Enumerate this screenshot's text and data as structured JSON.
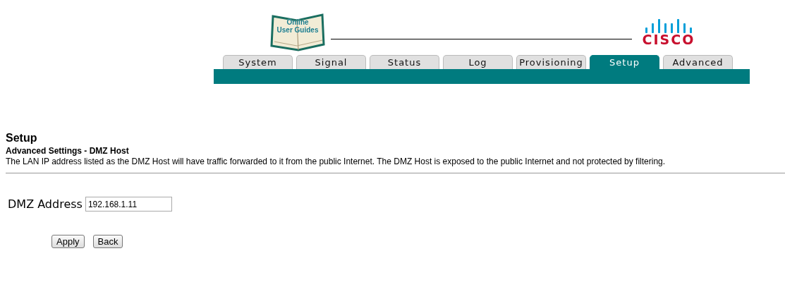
{
  "header": {
    "guide_logo": [
      "Online",
      "User Guides"
    ],
    "brand": "CISCO"
  },
  "tabs": [
    {
      "label": "System",
      "selected": false
    },
    {
      "label": "Signal",
      "selected": false
    },
    {
      "label": "Status",
      "selected": false
    },
    {
      "label": "Log",
      "selected": false
    },
    {
      "label": "Provisioning",
      "selected": false
    },
    {
      "label": "Setup",
      "selected": true
    },
    {
      "label": "Advanced",
      "selected": false
    }
  ],
  "page": {
    "title": "Setup",
    "subtitle": "Advanced Settings - DMZ Host",
    "description": "The LAN IP address listed as the DMZ Host will have traffic forwarded to it from the public Internet. The DMZ Host is exposed to the public Internet and not protected by filtering."
  },
  "form": {
    "label": "DMZ Address",
    "value": "192.168.1.11"
  },
  "buttons": [
    "Apply",
    "Back"
  ]
}
